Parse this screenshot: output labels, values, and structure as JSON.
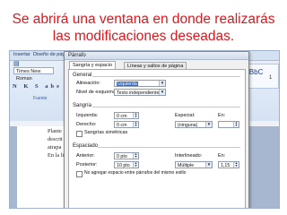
{
  "slide": {
    "title_line1": "Se abrirá una ventana en donde realizarás",
    "title_line2": "las modificaciones deseadas."
  },
  "word_window": {
    "ribbon_tabs": [
      "Insertar",
      "Diseño de pági"
    ],
    "font_name": "Times New Roman",
    "format_buttons": "N K S abe x₂ x²",
    "font_group_label": "Fuente",
    "style_preview": "AaBbC",
    "style_number": "1",
    "document_lines": [
      "Plante",
      "descrit",
      "atrapa",
      "En la li"
    ]
  },
  "dialog": {
    "title": "Párrafo",
    "tabs": [
      "Sangría y espacio",
      "Líneas y saltos de página"
    ],
    "sections": {
      "general": "General",
      "indent": "Sangría",
      "spacing": "Espaciado"
    },
    "general": {
      "alignment_label": "Alineación:",
      "alignment_value": "Izquierda",
      "outline_label": "Nivel de esquema:",
      "outline_value": "Texto independiente"
    },
    "indent": {
      "left_label": "Izquierda:",
      "left_value": "0 cm",
      "right_label": "Derecho:",
      "right_value": "0 cm",
      "special_label": "Especial:",
      "special_value": "(ninguna)",
      "by_label": "En:",
      "mirror_label": "Sangrías simétricas"
    },
    "spacing": {
      "before_label": "Anterior:",
      "before_value": "0 pto",
      "after_label": "Posterior:",
      "after_value": "10 pto",
      "line_label": "Interlineado:",
      "line_value": "Múltiple",
      "at_label": "En:",
      "at_value": "1,15",
      "no_space_label": "No agregar espacio entre párrafos del mismo estilo"
    }
  }
}
